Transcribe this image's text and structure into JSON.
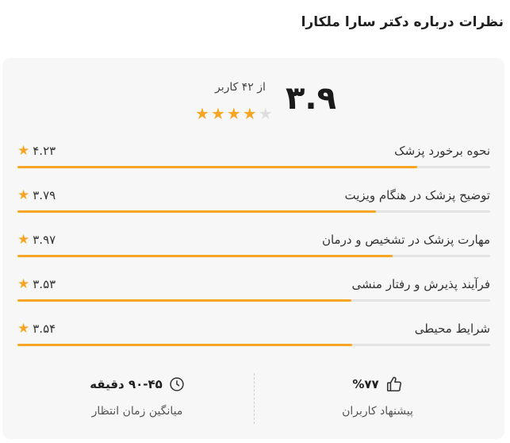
{
  "page": {
    "title": "نظرات درباره دکتر سارا ملکارا"
  },
  "summary": {
    "score": "۳.۹",
    "count_text": "از ۴۲ کاربر",
    "rating_stars": 3.9,
    "max_stars": 5
  },
  "criteria": [
    {
      "label": "نحوه برخورد پزشک",
      "score_text": "۴.۲۳",
      "value": 4.23
    },
    {
      "label": "توضیح پزشک در هنگام ویزیت",
      "score_text": "۳.۷۹",
      "value": 3.79
    },
    {
      "label": "مهارت پزشک در تشخیص و درمان",
      "score_text": "۳.۹۷",
      "value": 3.97
    },
    {
      "label": "فرآیند پذیرش و رفتار منشی",
      "score_text": "۳.۵۳",
      "value": 3.53
    },
    {
      "label": "شرایط محیطی",
      "score_text": "۳.۵۴",
      "value": 3.54
    }
  ],
  "stats": {
    "recommend": {
      "value": "%۷۷",
      "caption": "پیشنهاد کاربران",
      "icon": "thumbs-up-icon"
    },
    "wait": {
      "value": "۹۰-۴۵ دقیقه",
      "caption": "میانگین زمان انتظار",
      "icon": "clock-icon"
    }
  },
  "colors": {
    "accent": "#f6a623",
    "track": "#e3e3e3",
    "card_bg": "#f7f7f8"
  }
}
